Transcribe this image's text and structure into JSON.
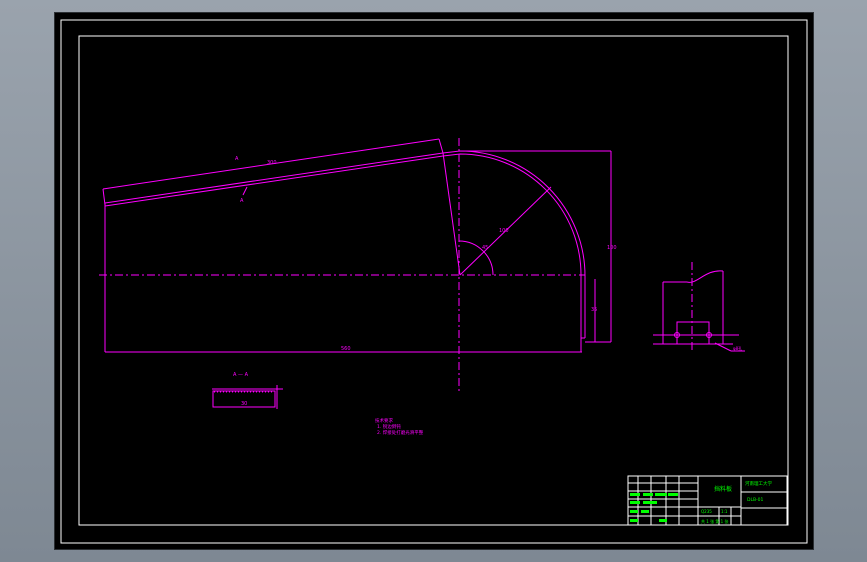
{
  "colors": {
    "background": "#000000",
    "geometry": "#ff00ff",
    "frame": "#ffffff",
    "title_text": "#00ff00"
  },
  "drawing": {
    "dimensions": {
      "slope_length": "300",
      "total_length": "560",
      "radius": "100",
      "right_height": "100",
      "small_height": "35",
      "angle": "45"
    },
    "labels": {
      "label_a_top": "A",
      "label_a_bottom": "A",
      "section_title": "A — A",
      "section_dim": "30",
      "detail_dim": "φ8孔"
    },
    "notes": {
      "heading": "技术要求",
      "line1": "1. 锐边倒钝",
      "line2": "2. 焊接处打磨光滑平整"
    }
  },
  "title_block": {
    "part_name": "挡料板",
    "school": "河南理工大学",
    "drawing_number": "DLB-01",
    "material": "Q235",
    "scale": "1:1",
    "sheet_info": "共 1 张  第 1 张"
  }
}
